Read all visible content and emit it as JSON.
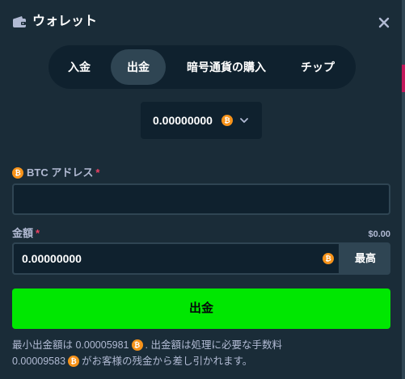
{
  "header": {
    "title": "ウォレット",
    "wallet_icon": "wallet-icon",
    "close_icon": "close-icon"
  },
  "tabs": [
    {
      "label": "入金",
      "active": false
    },
    {
      "label": "出金",
      "active": true
    },
    {
      "label": "暗号通貨の購入",
      "active": false
    },
    {
      "label": "チップ",
      "active": false
    }
  ],
  "currency": {
    "value": "0.00000000",
    "icon": "bitcoin-icon",
    "chevron": "chevron-down-icon"
  },
  "address": {
    "label": "BTC アドレス",
    "required": "*",
    "value": "",
    "placeholder": ""
  },
  "amount": {
    "label": "金額",
    "required": "*",
    "fiat": "$0.00",
    "value": "0.00000000",
    "max_label": "最高"
  },
  "withdraw_button": "出金",
  "notes": {
    "line1_a": "最小出金額は 0.00005981",
    "line1_b": ". 出金額は処理に必要な手数料",
    "line2_a": "0.00009583",
    "line2_b": "がお客様の残金から差し引かれます。"
  },
  "colors": {
    "background": "#1a2c38",
    "input_bg": "#0f212e",
    "border": "#2f4553",
    "accent_green": "#00e701",
    "btc_orange": "#f7931a",
    "required_red": "#ed4163",
    "muted_text": "#b1bad3"
  }
}
